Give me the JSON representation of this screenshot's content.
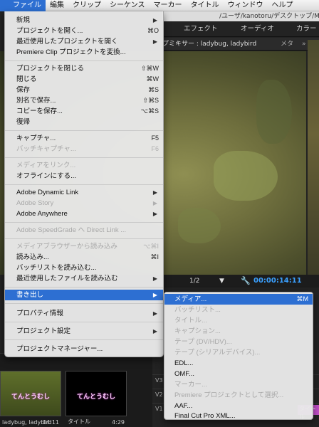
{
  "menubar": {
    "apple": "",
    "items": [
      "ファイル",
      "編集",
      "クリップ",
      "シーケンス",
      "マーカー",
      "タイトル",
      "ウィンドウ",
      "ヘルプ"
    ]
  },
  "app": {
    "path": "/ユーザ/kanotoru/デスクトップ/MyPr",
    "workspace_tabs": [
      "エフェクト",
      "オーディオ",
      "カラー"
    ],
    "program_tab": "プミキサー : ladybug, ladybird",
    "program_tab_extra": [
      "メタ",
      "»"
    ],
    "transport": {
      "fraction": "1/2",
      "dropdown": "▼",
      "timecode": "00:00:14:11"
    },
    "clips": [
      {
        "title": "てんとうむし",
        "name": "ladybug, ladybird",
        "duration": "14:11"
      },
      {
        "title": "てんとうむし",
        "name": "タイトル",
        "duration": "4:29"
      }
    ],
    "tracks": [
      "V3",
      "V2",
      "V1"
    ],
    "track_clip": "タイトル"
  },
  "file_menu": {
    "items": [
      {
        "label": "新規",
        "submenu": true
      },
      {
        "label": "プロジェクトを開く...",
        "shortcut": "⌘O"
      },
      {
        "label": "最近使用したプロジェクトを開く",
        "submenu": true
      },
      {
        "label": "Premiere Clip プロジェクトを変換..."
      },
      {
        "label": "プロジェクトを閉じる",
        "shortcut": "⇧⌘W"
      },
      {
        "label": "閉じる",
        "shortcut": "⌘W"
      },
      {
        "label": "保存",
        "shortcut": "⌘S"
      },
      {
        "label": "別名で保存...",
        "shortcut": "⇧⌘S"
      },
      {
        "label": "コピーを保存...",
        "shortcut": "⌥⌘S"
      },
      {
        "label": "復帰"
      },
      {
        "label": "キャプチャ...",
        "shortcut": "F5"
      },
      {
        "label": "バッチキャプチャ...",
        "shortcut": "F6",
        "disabled": true
      },
      {
        "label": "メディアをリンク...",
        "disabled": true
      },
      {
        "label": "オフラインにする..."
      },
      {
        "label": "Adobe Dynamic Link",
        "submenu": true
      },
      {
        "label": "Adobe Story",
        "submenu": true,
        "disabled": true
      },
      {
        "label": "Adobe Anywhere",
        "submenu": true
      },
      {
        "label": "Adobe SpeedGrade へ Direct Link ...",
        "disabled": true
      },
      {
        "label": "メディアブラウザーから読み込み",
        "shortcut": "⌥⌘I",
        "disabled": true
      },
      {
        "label": "読み込み...",
        "shortcut": "⌘I"
      },
      {
        "label": "バッチリストを読み込む..."
      },
      {
        "label": "最近使用したファイルを読み込む",
        "submenu": true
      },
      {
        "label": "書き出し",
        "submenu": true,
        "highlight": true
      },
      {
        "label": "プロパティ情報",
        "submenu": true
      },
      {
        "label": "プロジェクト設定",
        "submenu": true
      },
      {
        "label": "プロジェクトマネージャー..."
      }
    ]
  },
  "export_menu": {
    "items": [
      {
        "label": "メディア...",
        "shortcut": "⌘M",
        "highlight": true
      },
      {
        "label": "バッチリスト...",
        "disabled": true
      },
      {
        "label": "タイトル...",
        "disabled": true
      },
      {
        "label": "キャプション...",
        "disabled": true
      },
      {
        "label": "テープ (DV/HDV)...",
        "disabled": true
      },
      {
        "label": "テープ (シリアルデバイス)...",
        "disabled": true
      },
      {
        "label": "EDL..."
      },
      {
        "label": "OMF..."
      },
      {
        "label": "マーカー...",
        "disabled": true
      },
      {
        "label": "Premiere プロジェクトとして選択...",
        "disabled": true
      },
      {
        "label": "AAF..."
      },
      {
        "label": "Final Cut Pro XML..."
      }
    ]
  },
  "colors": {
    "highlight": "#2d6fd2",
    "timecode": "#3aa0ff",
    "title_clip": "#c24fc8"
  }
}
